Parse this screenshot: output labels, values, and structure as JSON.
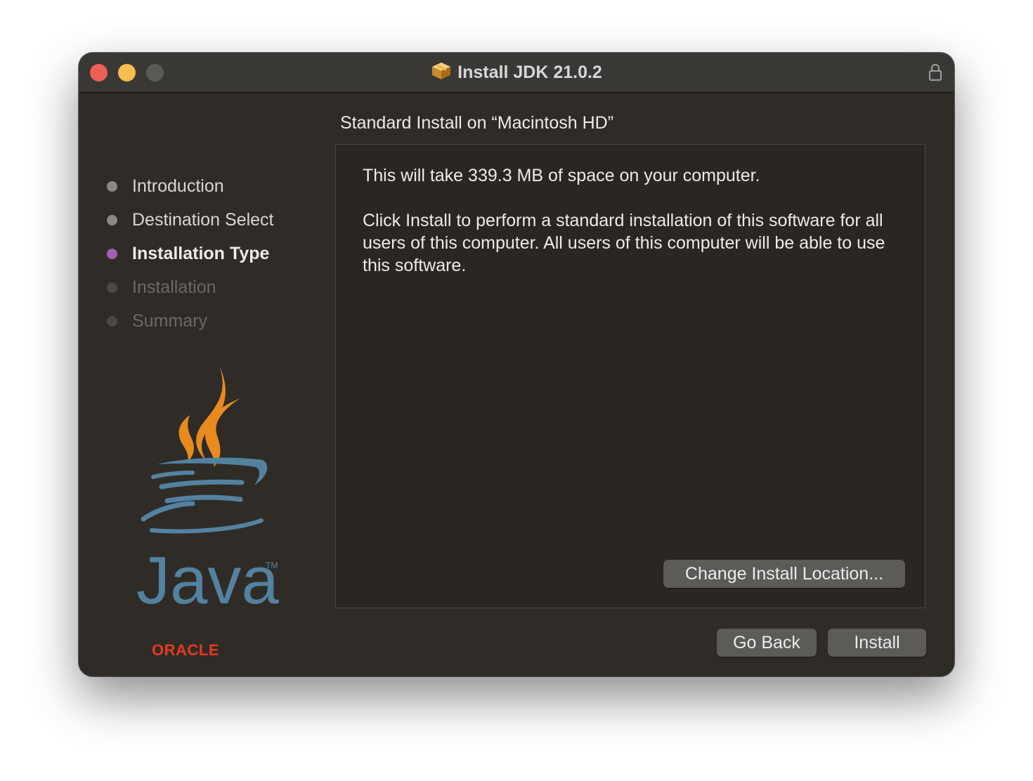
{
  "window": {
    "title": "Install JDK 21.0.2"
  },
  "subtitle": "Standard Install on “Macintosh HD”",
  "sidebar": {
    "steps": [
      {
        "label": "Introduction",
        "state": "done"
      },
      {
        "label": "Destination Select",
        "state": "done"
      },
      {
        "label": "Installation Type",
        "state": "active"
      },
      {
        "label": "Installation",
        "state": "future"
      },
      {
        "label": "Summary",
        "state": "future"
      }
    ]
  },
  "branding": {
    "java_logo": "Java",
    "java_trademark": "TM",
    "oracle_logo": "ORACLE"
  },
  "content": {
    "space_notice": "This will take 339.3 MB of space on your computer.",
    "description": "Click Install to perform a standard installation of this software for all users of this computer. All users of this computer will be able to use this software.",
    "change_location_label": "Change Install Location..."
  },
  "footer": {
    "go_back_label": "Go Back",
    "install_label": "Install"
  },
  "icons": [
    "package-icon",
    "lock-icon",
    "java-logo",
    "oracle-logo"
  ],
  "colors": {
    "active_step_dot": "#a55db5",
    "close": "#ee5f57",
    "minimize": "#f5bd4f",
    "oracle_red": "#e8391f",
    "java_blue": "#5382a1",
    "java_orange": "#e76f00"
  }
}
